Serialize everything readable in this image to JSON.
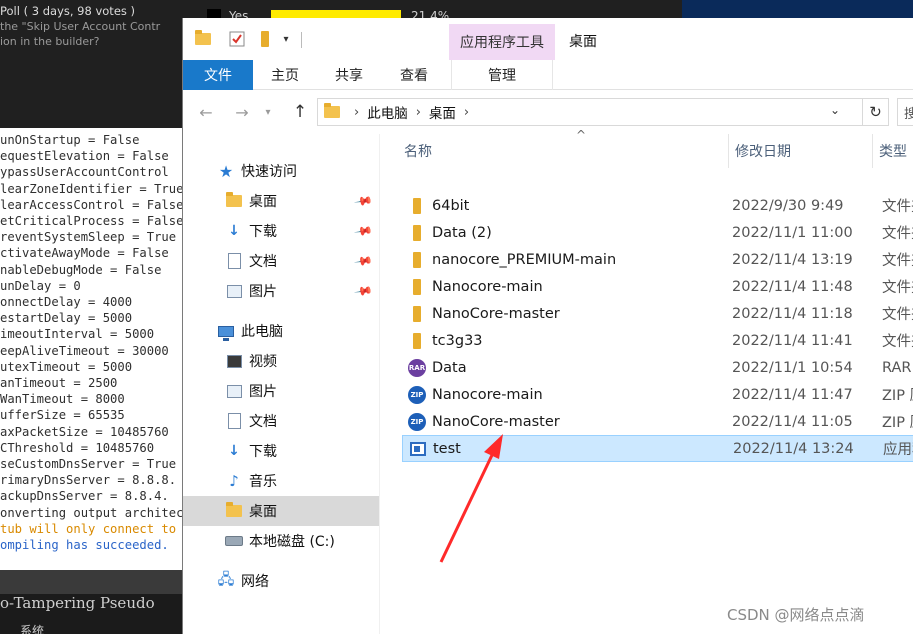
{
  "background": {
    "poll_lines": [
      "Poll ( 3 days, 98 votes )",
      "the \"Skip User Account Contr",
      "ion in the builder?"
    ],
    "poll_option": "Yes",
    "poll_percent": "21.4%",
    "poll_fraction": 0.214,
    "console_lines": [
      "unOnStartup = False",
      "equestElevation = False",
      "ypassUserAccountControl",
      "learZoneIdentifier = True",
      "learAccessControl = False",
      "etCriticalProcess = False",
      "reventSystemSleep = True",
      "ctivateAwayMode = False",
      "nableDebugMode = False",
      "unDelay = 0",
      "onnectDelay = 4000",
      "estartDelay = 5000",
      "imeoutInterval = 5000",
      "eepAliveTimeout = 30000",
      "utexTimeout = 5000",
      "anTimeout = 2500",
      "WanTimeout = 8000",
      "ufferSize = 65535",
      "axPacketSize = 10485760",
      "CThreshold = 10485760",
      "seCustomDnsServer = True",
      "rimaryDnsServer = 8.8.8.",
      "ackupDnsServer = 8.8.4.",
      "onverting output architect",
      "tub will only connect to th",
      "ompiling has succeeded."
    ],
    "bottom_text": "o-Tampering Pseudo",
    "bottom_text2": "系统"
  },
  "explorer": {
    "context_tab": "应用程序工具",
    "title": "桌面",
    "ribbon_tabs": {
      "file": "文件",
      "home": "主页",
      "share": "共享",
      "view": "查看",
      "manage": "管理"
    },
    "address": {
      "crumbs": [
        "此电脑",
        "桌面"
      ],
      "search_stub": "搜"
    },
    "sidebar": {
      "quick_access": "快速访问",
      "quick_items": [
        "桌面",
        "下载",
        "文档",
        "图片"
      ],
      "this_pc": "此电脑",
      "pc_items": [
        "视频",
        "图片",
        "文档",
        "下载",
        "音乐",
        "桌面",
        "本地磁盘 (C:)"
      ],
      "network": "网络",
      "selected": "桌面"
    },
    "columns": {
      "name": "名称",
      "date": "修改日期",
      "type": "类型"
    },
    "files": [
      {
        "name": "64bit",
        "date": "2022/9/30 9:49",
        "type": "文件夹",
        "icon": "folder-icon"
      },
      {
        "name": "Data (2)",
        "date": "2022/11/1 11:00",
        "type": "文件夹",
        "icon": "folder-icon"
      },
      {
        "name": "nanocore_PREMIUM-main",
        "date": "2022/11/4 13:19",
        "type": "文件夹",
        "icon": "folder-icon"
      },
      {
        "name": "Nanocore-main",
        "date": "2022/11/4 11:48",
        "type": "文件夹",
        "icon": "folder-icon"
      },
      {
        "name": "NanoCore-master",
        "date": "2022/11/4 11:18",
        "type": "文件夹",
        "icon": "folder-icon"
      },
      {
        "name": "tc3g33",
        "date": "2022/11/4 11:41",
        "type": "文件夹",
        "icon": "folder-icon"
      },
      {
        "name": "Data",
        "date": "2022/11/1 10:54",
        "type": "RAR",
        "icon": "rar-icon"
      },
      {
        "name": "Nanocore-main",
        "date": "2022/11/4 11:47",
        "type": "ZIP 压",
        "icon": "zip-icon"
      },
      {
        "name": "NanoCore-master",
        "date": "2022/11/4 11:05",
        "type": "ZIP 压",
        "icon": "zip-icon"
      },
      {
        "name": "test",
        "date": "2022/11/4 13:24",
        "type": "应用程",
        "icon": "exe-icon"
      }
    ],
    "selected_file": "test"
  },
  "watermark": "CSDN @网络点点滴",
  "colors": {
    "ribbon_file_tab": "#1979ca",
    "context_tab": "#f1d9f4",
    "selection": "#cce8ff",
    "annotation_arrow": "#ff2a2a",
    "poll_bar": "#ffeb00"
  }
}
